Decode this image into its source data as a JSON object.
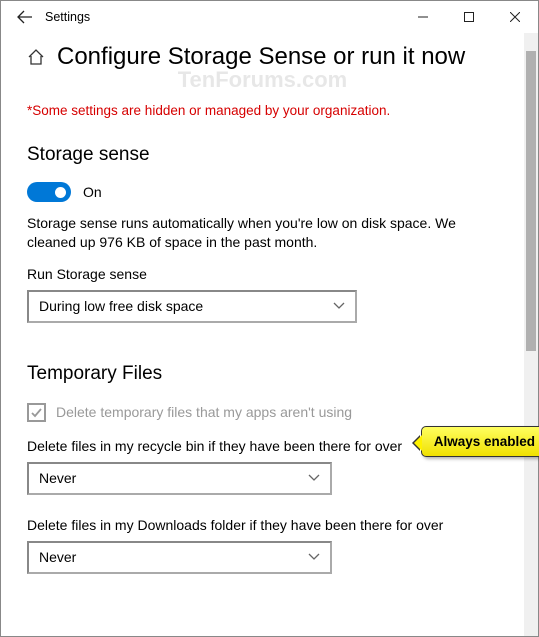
{
  "window": {
    "title": "Settings"
  },
  "page": {
    "heading": "Configure Storage Sense or run it now",
    "watermark": "TenForums.com",
    "policy_notice": "*Some settings are hidden or managed by your organization."
  },
  "storage_sense": {
    "heading": "Storage sense",
    "toggle_label": "On",
    "toggle_on": true,
    "description": "Storage sense runs automatically when you're low on disk space. We cleaned up 976 KB of space in the past month.",
    "run_label": "Run Storage sense",
    "run_value": "During low free disk space"
  },
  "temp_files": {
    "heading": "Temporary Files",
    "delete_temp_label": "Delete temporary files that my apps aren't using",
    "recycle_label": "Delete files in my recycle bin if they have been there for over",
    "recycle_value": "Never",
    "downloads_label": "Delete files in my Downloads folder if they have been there for over",
    "downloads_value": "Never"
  },
  "callout": {
    "text": "Always enabled"
  }
}
